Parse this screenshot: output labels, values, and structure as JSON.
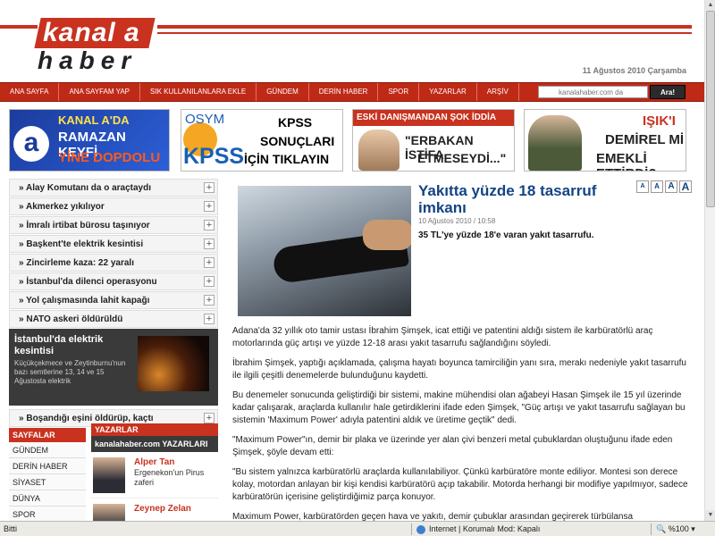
{
  "header": {
    "logo_top": "kanal a",
    "logo_bottom": "haber",
    "date": "11 Ağustos 2010 Çarşamba"
  },
  "nav": {
    "items": [
      "ANA SAYFA",
      "ANA SAYFAM YAP",
      "SIK KULLANILANLARA EKLE",
      "GÜNDEM",
      "DERİN HABER",
      "SPOR",
      "YAZARLAR",
      "ARŞİV"
    ],
    "search_placeholder": "kanalahaber.com da",
    "search_button": "Ara!"
  },
  "banners": {
    "b1": {
      "line1": "KANAL A'DA",
      "line2": "RAMAZAN KEYFİ",
      "line3": "YİNE DOPDOLU"
    },
    "b2": {
      "brand": "OSYM",
      "kpss": "KPSS",
      "line1": "KPSS",
      "line2": "SONUÇLARI",
      "line3": "İÇİN TIKLAYIN"
    },
    "b3": {
      "head": "ESKİ DANIŞMANDAN ŞOK İDDİA",
      "line1": "\"ERBAKAN İSTİFA",
      "line2": "ETMESEYDİ...\""
    },
    "b4": {
      "line1": "IŞIK'I",
      "line2": "DEMİREL Mİ",
      "line3": "EMEKLİ ETTİRDİ?"
    }
  },
  "left": {
    "news": [
      "Alay Komutanı da o araçtaydı",
      "Akmerkez yıkılıyor",
      "İmralı irtibat bürosu taşınıyor",
      "Başkent'te elektrik kesintisi",
      "Zincirleme kaza: 22 yaralı",
      "İstanbul'da dilenci operasyonu",
      "Yol çalışmasında lahit kapağı",
      "NATO askeri öldürüldü"
    ],
    "feature": {
      "title": "İstanbul'da elektrik kesintisi",
      "summary": "Küçükçekmece ve Zeytinburnu'nun bazı semtlerine 13, 14 ve 15 Ağustosta elektrik"
    },
    "news_after": "Boşandığı eşini öldürüp, kaçtı",
    "sections_head": "SAYFALAR",
    "sections": [
      "GÜNDEM",
      "DERİN HABER",
      "SİYASET",
      "DÜNYA",
      "SPOR"
    ]
  },
  "writers": {
    "head": "YAZARLAR",
    "subhead": "kanalahaber.com YAZARLARI",
    "items": [
      {
        "name": "Alper Tan",
        "subtitle": "Ergenekon'un Pirus zaferi"
      },
      {
        "name": "Zeynep Zelan",
        "subtitle": ""
      }
    ]
  },
  "article": {
    "title": "Yakıtta yüzde 18 tasarruf imkanı",
    "date": "10 Ağustos 2010 / 10:58",
    "lead": "35 TL'ye yüzde 18'e varan yakıt tasarrufu.",
    "font_buttons": [
      "A",
      "A",
      "A",
      "A"
    ],
    "paragraphs": [
      "Adana'da 32 yıllık oto tamir ustası İbrahim Şimşek, icat ettiği ve patentini aldığı sistem ile karbüratörlü araç motorlarında güç artışı ve yüzde 12-18 arası yakıt tasarrufu sağlandığını söyledi.",
      "İbrahim Şimşek, yaptığı açıklamada, çalışma hayatı boyunca tamirciliğin yanı sıra, merakı nedeniyle yakıt tasarrufu ile ilgili çeşitli denemelerde bulunduğunu kaydetti.",
      "Bu denemeler sonucunda geliştirdiği bir sistemi, makine mühendisi olan ağabeyi Hasan Şimşek ile 15 yıl üzerinde kadar çalışarak, araçlarda kullanılır hale getirdiklerini ifade eden Şimşek, \"Güç artışı ve yakıt tasarrufu sağlayan bu sistemin 'Maximum Power' adıyla patentini aldık ve üretime geçtik\" dedi.",
      "\"Maximum Power\"ın, demir bir plaka ve üzerinde yer alan çivi benzeri metal çubuklardan oluştuğunu ifade eden Şimşek, şöyle devam etti:",
      "\"Bu sistem yalnızca karbüratörlü araçlarda kullanılabiliyor. Çünkü karbüratöre monte ediliyor. Montesi son derece kolay, motordan anlayan bir kişi kendisi karbüratörü açıp takabilir. Motorda herhangi bir modifiye yapılmıyor, sadece karbüratörün içerisine geliştirdiğimiz parça konuyor.",
      "Maximum Power, karbüratörden geçen hava ve yakıtı, demir çubuklar arasından geçirerek türbülansa"
    ]
  },
  "statusbar": {
    "left": "Bitti",
    "zone": "Internet | Korumalı Mod: Kapalı",
    "zoom": "%100"
  }
}
